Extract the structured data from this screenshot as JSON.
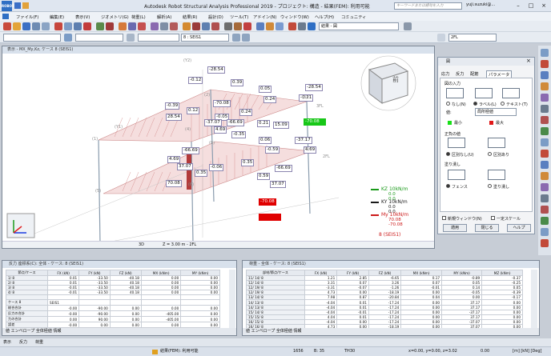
{
  "app": {
    "title": "Autodesk Robot Structural Analysis Professional 2019 - プロジェクト: 構造 - 結果(FEM): 利用可能",
    "search_placeholder": "キーワードまたは語句を入力",
    "user": "yuji.suzuki@...",
    "logo": "ROBOT"
  },
  "menu": [
    "ファイル(F)",
    "編集(E)",
    "表示(V)",
    "ジオメトリ(G)",
    "荷重(L)",
    "解析(A)",
    "結果(R)",
    "設計(D)",
    "ツール(T)",
    "アドイン(N)",
    "ウィンドウ(W)",
    "ヘルプ(H)",
    "コミュニティ"
  ],
  "toolbar": {
    "result_select": "結果 - 図",
    "case_select": "8 : SEIS1",
    "story_select": "2FL"
  },
  "viewport": {
    "title": "表示 - MX_My,Kz, ケース 8 (SEIS1)",
    "mode": "3D",
    "z_label": "Z = 3.00 m - 2FL",
    "view_cube_label": "前",
    "case_tag": "8 (SEIS1)"
  },
  "diagram": {
    "top_labels": [
      "-28.54",
      "-0.12",
      "0.39",
      "0.05",
      "-28.54",
      "0.24",
      "-0.21",
      "-0.39",
      "0.12",
      "-70.08",
      "28.54",
      "0.24",
      "-0.05",
      "-66.69",
      "-37.07",
      "15.09",
      "0.21",
      "4.69",
      "-0.35",
      "-70.08"
    ],
    "mid_labels": [
      "0.06",
      "-37.17",
      "-66.69",
      "-0.59",
      "4.69",
      "4.69",
      "-0.06",
      "0.35",
      "-66.69",
      "0.59",
      "37.07",
      "0.35",
      "37.07",
      "70.08",
      "-70.08"
    ],
    "nodes": [
      "(3)",
      "(4)",
      "(2)",
      "(1)",
      "(7)",
      "(6)",
      "(8)",
      "(5)",
      "3FL",
      "2FL",
      "(Y2)",
      "(Y1)"
    ]
  },
  "legend": {
    "kz": "KZ 10kN/m",
    "kz_v1": "0.0",
    "kz_v2": "0.0",
    "ky": "KY 10kN/m",
    "ky_v1": "0.0",
    "ky_v2": "0.0",
    "my": "My 10kN/m",
    "my_v1": "70.08",
    "my_v2": "-70.08"
  },
  "dialog": {
    "title": "図",
    "tabs": [
      "応力",
      "反力",
      "配筋",
      "パラメータ"
    ],
    "diagram_input": "図の入力",
    "opt_none": "なし(N)",
    "opt_labels": "ラベル(L)",
    "opt_text": "テキスト(T)",
    "values_label": "値:",
    "values_select": "局所極値",
    "min_label": "最小",
    "max_label": "最大",
    "positive": "正負の値",
    "opt_split": "区別なし(U)",
    "opt_split2": "区別あり",
    "fill": "塗り潰し",
    "opt_fence": "フェンス",
    "opt_fill": "塗り潰し",
    "chk_new": "新規ウィンドウ(N)",
    "chk_scale": "一定スケール",
    "apply": "適用",
    "close": "閉じる",
    "help": "ヘルプ",
    "min_color": "#18e018",
    "max_color": "#e01818"
  },
  "table_left": {
    "title": "反力 座標系(C): 全体 - ケース: 8 (SEIS1)",
    "headers": [
      "節点/ケース",
      "FX (kN)",
      "FY (kN)",
      "FZ (kN)",
      "MX (kNm)",
      "MY (kNm)"
    ],
    "rows": [
      [
        "1/ 8",
        "0.01",
        "-33.50",
        "-40.18",
        "0.00",
        "0.00"
      ],
      [
        "2/ 8",
        "0.01",
        "-33.50",
        "40.18",
        "0.00",
        "0.00"
      ],
      [
        "3/ 8",
        "-0.01",
        "-33.50",
        "-40.18",
        "0.00",
        "0.00"
      ],
      [
        "4/ 8",
        "-0.01",
        "-33.50",
        "40.18",
        "0.00",
        "0.00"
      ],
      [
        "",
        "",
        " ",
        "",
        "",
        ""
      ],
      [
        "ケース 8",
        "SEIS1",
        "",
        "",
        "",
        ""
      ],
      [
        "総合合計",
        "-0.00",
        "-90.00",
        "0.00",
        "0.00",
        "0.00"
      ],
      [
        "反力の合計",
        "-0.00",
        "-90.00",
        "0.00",
        "-405.00",
        "0.00"
      ],
      [
        "力の合計",
        "0.00",
        "90.00",
        "0.00",
        "-405.00",
        "0.00"
      ],
      [
        "誤差",
        "-0.00",
        "0.00",
        "0.00",
        "0.00",
        "0.00"
      ],
      [
        "誤差 %",
        "0.00%",
        "0.00%",
        "0.00%",
        "0.00%",
        "0.00%"
      ]
    ],
    "tabs": "値 エンベロープ 全体極値 情報"
  },
  "table_right": {
    "title": "荷重 - 全体 - ケース: 8 (SEIS1)",
    "headers": [
      "部材/節点/ケース",
      "FX (kN)",
      "FY (kN)",
      "FZ (kN)",
      "MX (kNm)",
      "MY (kNm)",
      "MZ (kNm)"
    ],
    "rows": [
      [
        "11/ 14/ 8",
        "1.21",
        "2.85",
        "-6.65",
        "0.17",
        "-0.89",
        "-0.37"
      ],
      [
        "12/ 14/ 8",
        "3.31",
        "0.07",
        "3.26",
        "0.07",
        "0.05",
        "-0.25"
      ],
      [
        "12/ 19/ 8",
        "-3.31",
        "-0.07",
        "-1.26",
        "-0.01",
        "0.14",
        "0.05"
      ],
      [
        "12/ 19/ 8",
        "4.73",
        "0.00",
        "-18.19",
        "0.00",
        "-0.05",
        "-0.39"
      ],
      [
        "13/ 14/ 8",
        "7.98",
        "0.87",
        "-20.84",
        "0.04",
        "0.00",
        "-0.17"
      ],
      [
        "14/ 13/ 8",
        "-4.04",
        "0.01",
        "-17.24",
        "0.00",
        "37.17",
        "0.00"
      ],
      [
        "14/ 13/ 8",
        "-4.04",
        "0.01",
        "-17.24",
        "0.00",
        "37.17",
        "0.00"
      ],
      [
        "15/ 14/ 8",
        "-4.04",
        "-0.01",
        "-17.24",
        "0.00",
        "-37.17",
        "0.00"
      ],
      [
        "15/ 15/ 8",
        "4.04",
        "0.01",
        "-17.24",
        "0.00",
        "37.17",
        "0.00"
      ],
      [
        "16/ 15/ 8",
        "-4.04",
        "0.00",
        "-17.24",
        "0.00",
        "-37.07",
        "0.00"
      ],
      [
        "16/ 16/ 8",
        "4.73",
        "0.00",
        "-18.19",
        "0.00",
        "37.07",
        "0.00"
      ]
    ],
    "tabs": "値 エンベロープ 全体極値 情報"
  },
  "bottom_tabs": [
    "表示",
    "反力",
    "荷重"
  ],
  "status": {
    "msg": "結果(FEM): 利用可能",
    "n1": "1656",
    "n2": "B: 35",
    "n3": "TH30",
    "coords": "x=0.00, y=0.00, z=3.02",
    "angle": "0.00",
    "units": "[m] [kN] [Deg]"
  }
}
